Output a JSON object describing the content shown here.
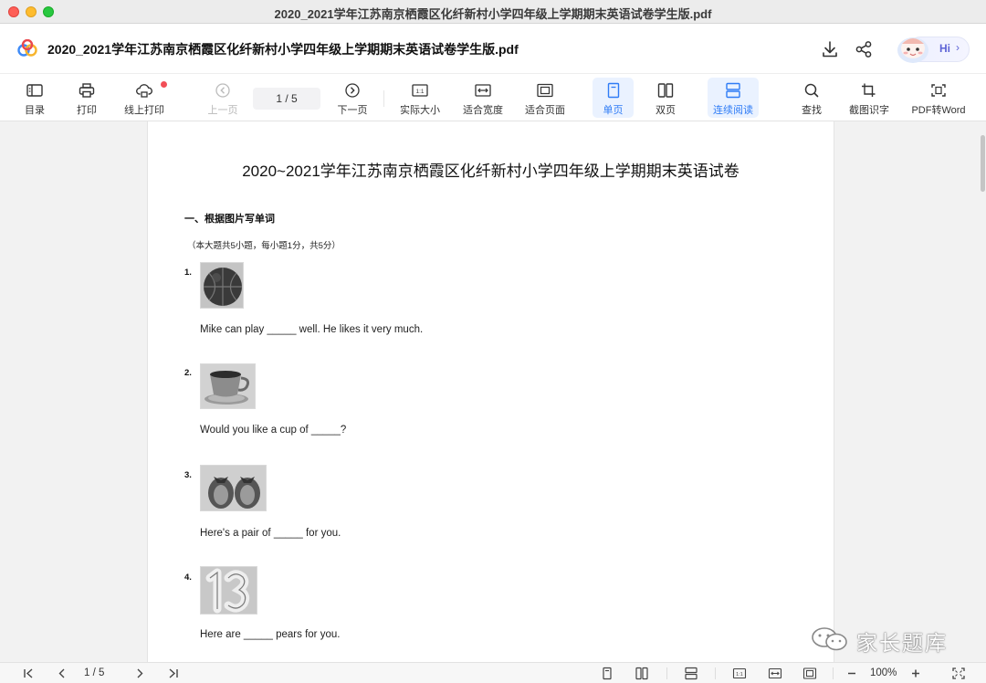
{
  "window": {
    "title": "2020_2021学年江苏南京栖霞区化纤新村小学四年级上学期期末英语试卷学生版.pdf"
  },
  "header": {
    "doc_title": "2020_2021学年江苏南京栖霞区化纤新村小学四年级上学期期末英语试卷学生版.pdf",
    "assistant_label": "Hi",
    "assistant_chevron": "›"
  },
  "toolbar": {
    "toc": "目录",
    "print": "打印",
    "online_print": "线上打印",
    "prev_page": "上一页",
    "page_indicator": "1 / 5",
    "next_page": "下一页",
    "actual_size": "实际大小",
    "fit_width": "适合宽度",
    "fit_page": "适合页面",
    "single_page": "单页",
    "double_page": "双页",
    "continuous": "连续阅读",
    "find": "查找",
    "ocr": "截图识字",
    "to_word": "PDF转Word"
  },
  "document": {
    "title": "2020~2021学年江苏南京栖霞区化纤新村小学四年级上学期期末英语试卷",
    "section_title": "一、根据图片写单词",
    "section_note": "（本大题共5小题，每小题1分，共5分）",
    "questions": [
      {
        "num": "1.",
        "text": "Mike can play _____ well. He likes it very much.",
        "image": "basketball"
      },
      {
        "num": "2.",
        "text": "Would you like a cup of _____?",
        "image": "teacup"
      },
      {
        "num": "3.",
        "text": "Here's a pair of _____ for you.",
        "image": "shoes"
      },
      {
        "num": "4.",
        "text": "Here are _____ pears for you.",
        "image": "number-13"
      }
    ]
  },
  "watermark": {
    "text": "家长题库"
  },
  "statusbar": {
    "page_indicator": "1 / 5",
    "zoom": "100%"
  }
}
